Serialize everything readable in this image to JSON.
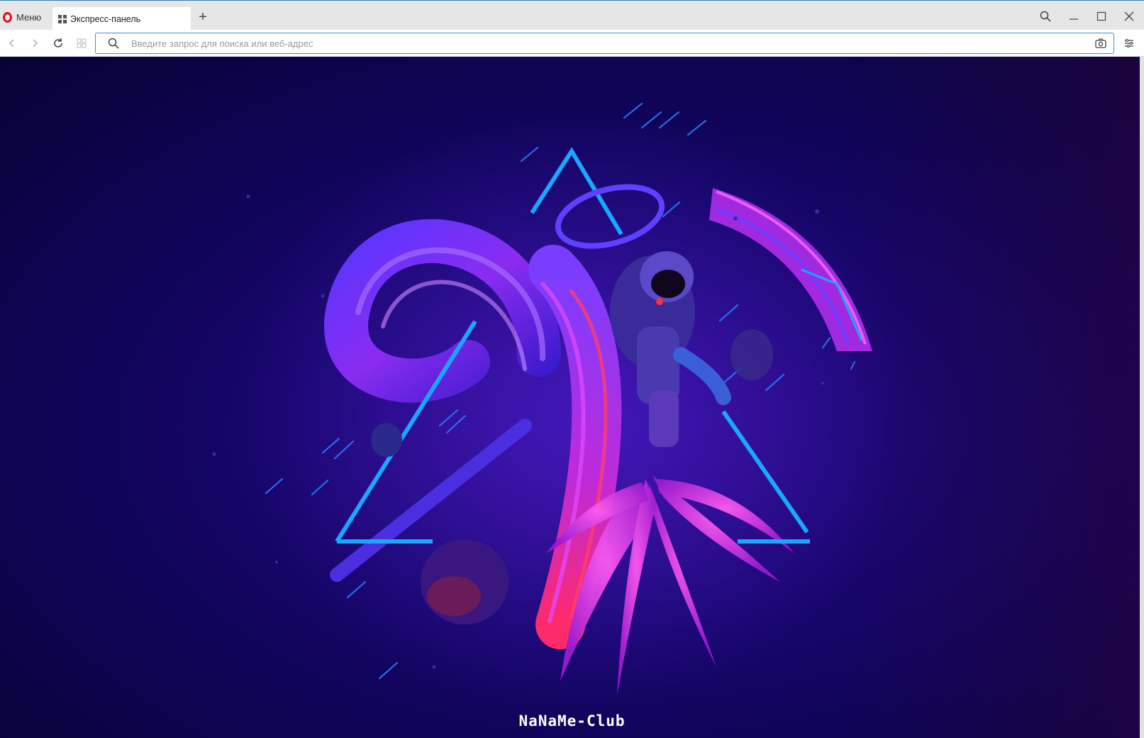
{
  "browser": {
    "menu_label": "Меню",
    "active_tab_title": "Экспресс-панель",
    "new_tab_symbol": "+"
  },
  "addressbar": {
    "placeholder": "Введите запрос для поиска или веб-адрес",
    "value": ""
  },
  "icons": {
    "back": "chevron-left-icon",
    "forward": "chevron-right-icon",
    "reload": "reload-icon",
    "tabs": "grid-icon",
    "search": "search-icon",
    "snapshot": "camera-icon",
    "easy_setup": "menu-lines-icon",
    "minimize": "minimize-icon",
    "maximize": "maximize-icon",
    "close": "close-icon"
  },
  "colors": {
    "opera_red": "#e0101e",
    "accent_blue": "#3b8fd6",
    "neon_cyan": "#1aa7ff",
    "neon_pink": "#e22ee0",
    "background_deep": "#0c0450"
  },
  "wallpaper": {
    "watermark_text": "NaNaMe-Club"
  }
}
